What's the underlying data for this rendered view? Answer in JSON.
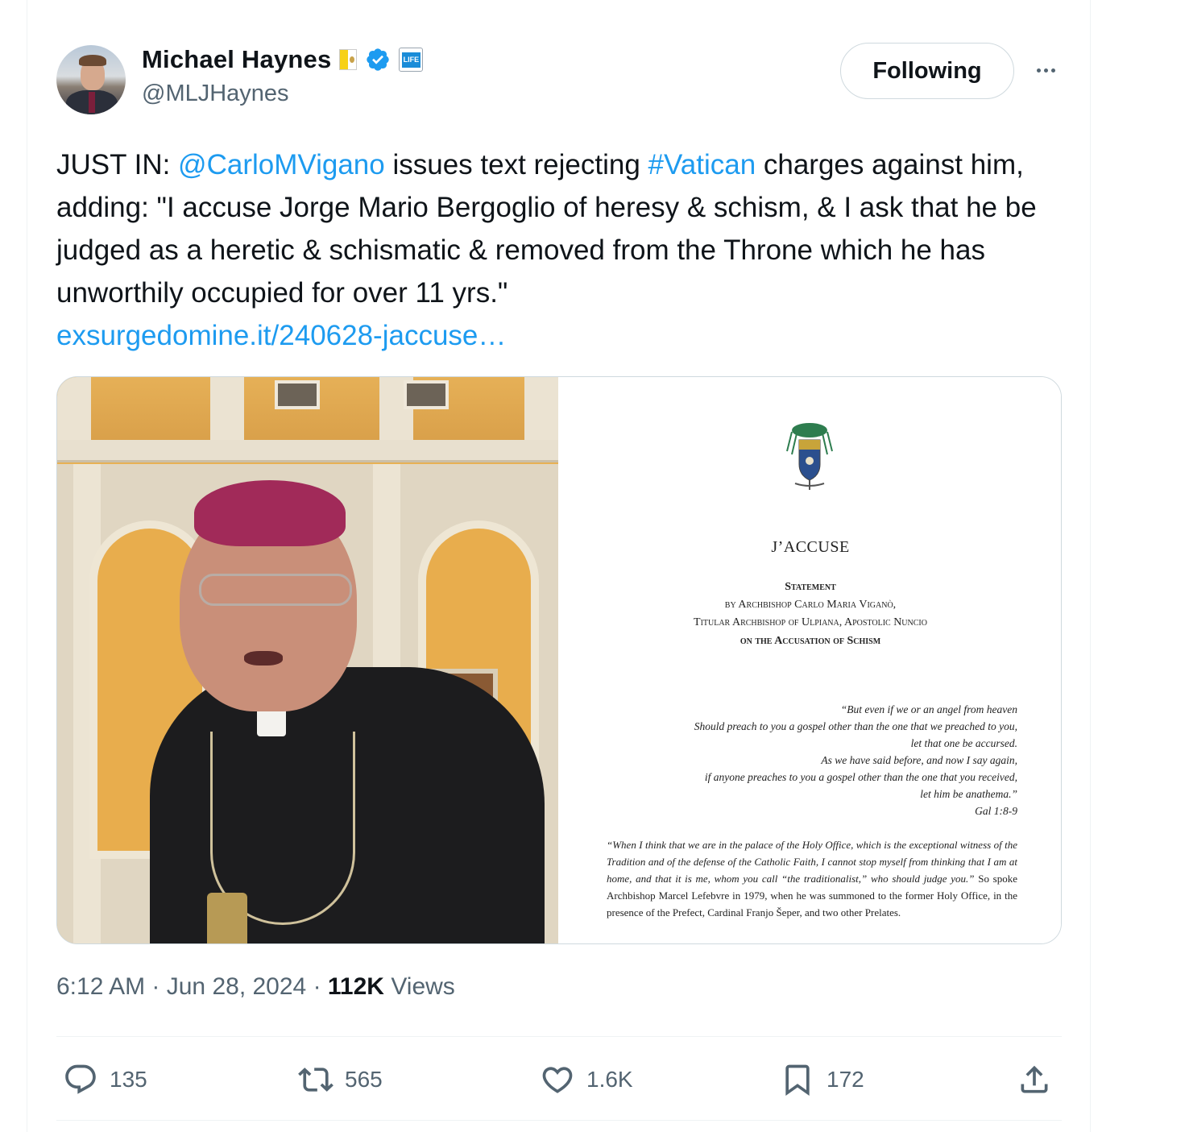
{
  "author": {
    "display_name": "Michael Haynes",
    "handle": "@MLJHaynes",
    "affiliate_badge": "LIFE",
    "icons": [
      "vatican-flag-icon",
      "verified-icon",
      "affiliate-badge-icon"
    ]
  },
  "follow_button": {
    "label": "Following"
  },
  "tweet": {
    "prefix": "JUST IN: ",
    "mention": "@CarloMVigano",
    "text_a": " issues text rejecting ",
    "hashtag": "#Vatican",
    "text_b": " charges against him, adding: \"I accuse Jorge Mario Bergoglio of heresy & schism, & I ask that he be judged as a heretic & schismatic & removed from the Throne which he has unworthily occupied for over 11 yrs.\"",
    "link": "exsurgedomine.it/240628-jaccuse…"
  },
  "document": {
    "title": "J’ACCUSE",
    "statement": "Statement",
    "by": "by Archbishop Carlo Maria Viganò,",
    "titular": "Titular Archbishop of Ulpiana, Apostolic Nuncio",
    "on": "on the Accusation of Schism",
    "quote_lines": [
      "“But even if we or an angel from heaven",
      "Should preach to you a gospel other than the one that we preached to you,",
      "let that one be accursed.",
      "As we have said before, and now I say again,",
      "if anyone preaches to you a gospel other than the one that you received,",
      "let him be anathema.”",
      "Gal 1:8-9"
    ],
    "para_italic": "“When I think that we are in the palace of the Holy Office, which is the exceptional witness of the Tradition and of the defense of the Catholic Faith, I cannot stop myself from thinking that I am at home, and that it is me, whom you call “the traditionalist,” who should judge you.”",
    "para_plain": " So spoke Archbishop Marcel Lefebvre in 1979, when he was summoned to the former Holy Office, in the presence of the Prefect, Cardinal Franjo Šeper, and two other Prelates."
  },
  "meta": {
    "time": "6:12 AM",
    "sep1": " · ",
    "date": "Jun 28, 2024",
    "sep2": " · ",
    "views_count": "112K",
    "views_label": " Views"
  },
  "actions": {
    "replies": "135",
    "reposts": "565",
    "likes": "1.6K",
    "bookmarks": "172"
  },
  "colors": {
    "link": "#1d9bf0",
    "text": "#0f1419",
    "secondary": "#536471",
    "border": "#cfd9de"
  }
}
